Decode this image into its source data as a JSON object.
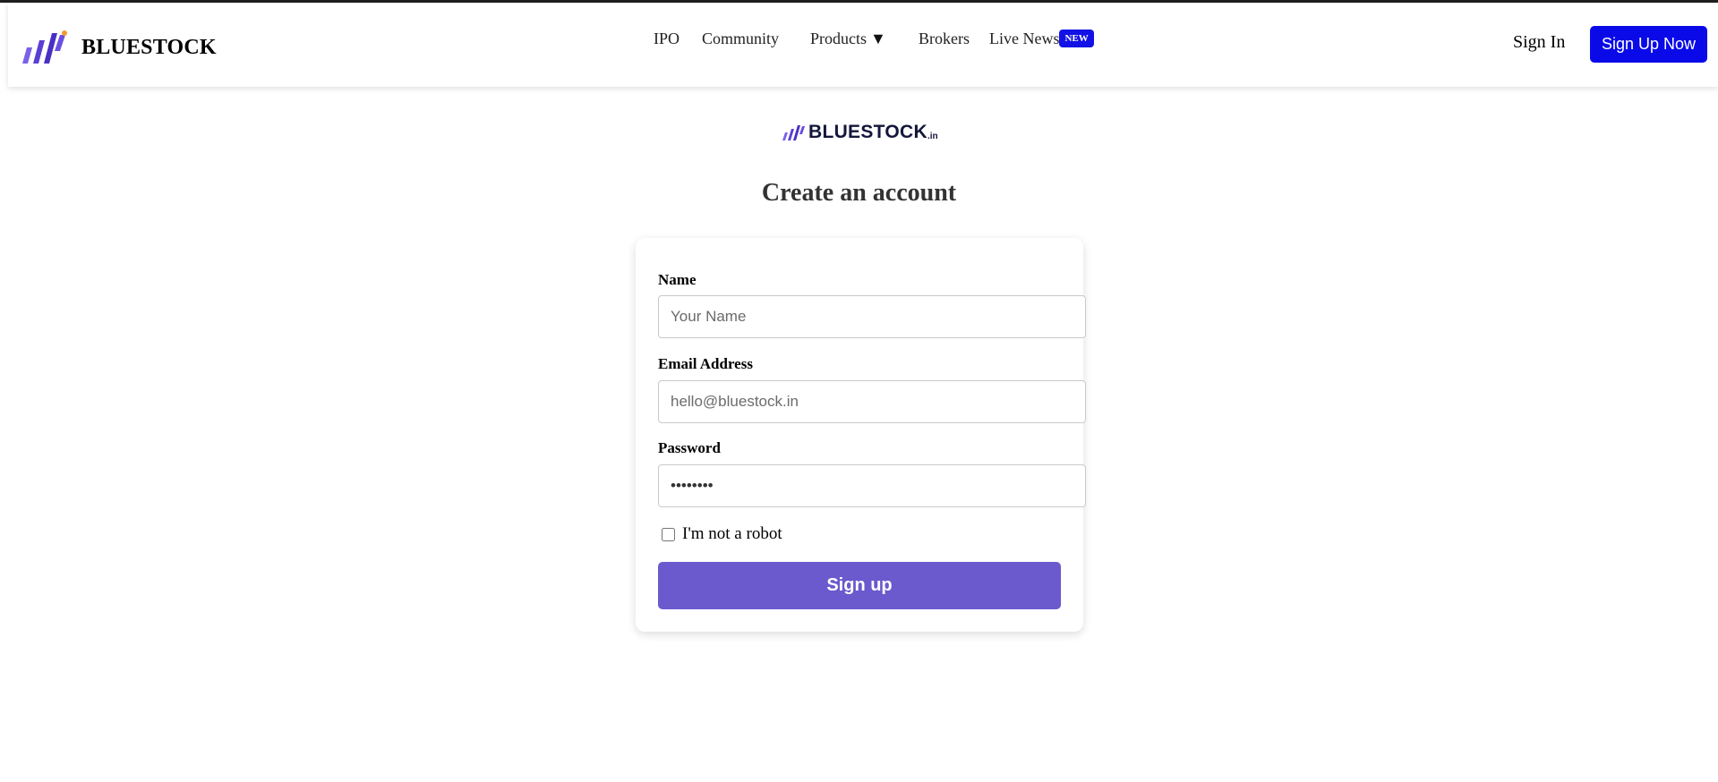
{
  "navbar": {
    "brand": "BLUESTOCK",
    "links": {
      "ipo": "IPO",
      "community": "Community",
      "products": "Products",
      "products_caret": "▼",
      "brokers": "Brokers",
      "live_news": "Live News",
      "new_badge": "NEW"
    },
    "sign_in": "Sign In",
    "sign_up_now": "Sign Up Now"
  },
  "center_logo": {
    "text": "BLUESTOCK",
    "suffix": ".in"
  },
  "page_title": "Create an account",
  "form": {
    "name_label": "Name",
    "name_placeholder": "Your Name",
    "email_label": "Email Address",
    "email_placeholder": "hello@bluestock.in",
    "password_label": "Password",
    "password_value": "••••••••",
    "robot_label": "I'm not a robot",
    "robot_checked": false,
    "submit_label": "Sign up"
  },
  "colors": {
    "brand_blue": "#0a0ae8",
    "submit_purple": "#6a5acd",
    "logo_purple": "#5b3fd4",
    "logo_accent": "#f29a2e"
  }
}
